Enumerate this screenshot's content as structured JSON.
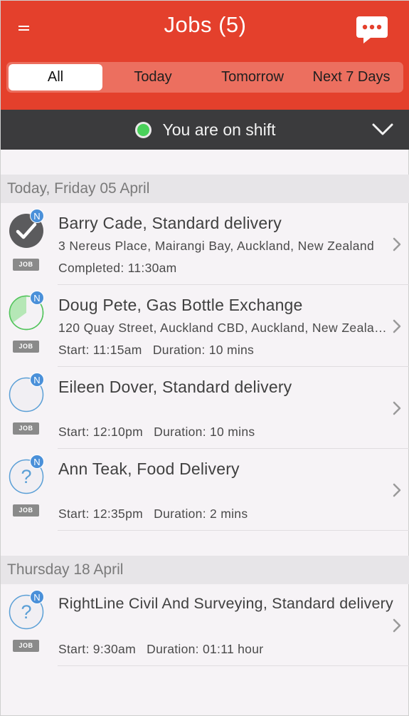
{
  "header": {
    "title": "Jobs (5)",
    "menu_icon": "menu-icon",
    "chat_icon": "chat-bubble-icon",
    "background_color": "#e4402c"
  },
  "tabs": [
    {
      "label": "All",
      "active": true
    },
    {
      "label": "Today",
      "active": false
    },
    {
      "label": "Tomorrow",
      "active": false
    },
    {
      "label": "Next 7 Days",
      "active": false
    }
  ],
  "shift": {
    "status_text": "You are on shift",
    "status_color": "#49d15a",
    "chevron_icon": "chevron-down-icon"
  },
  "sections": [
    {
      "header": "Today, Friday 05 April",
      "jobs": [
        {
          "title": "Barry Cade, Standard delivery",
          "address": "3 Nereus Place, Mairangi Bay, Auckland, New Zealand",
          "status_icon": "completed-check-icon",
          "badge": "N",
          "tag": "JOB",
          "completed_label": "Completed: 11:30am"
        },
        {
          "title": "Doug Pete, Gas Bottle Exchange",
          "address": "120 Quay Street, Auckland CBD, Auckland, New Zealand",
          "status_icon": "progress-pie-icon",
          "progress": 0.35,
          "badge": "N",
          "tag": "JOB",
          "start": "Start: 11:15am",
          "duration": "Duration: 10 mins"
        },
        {
          "title": "Eileen Dover, Standard delivery",
          "address": "",
          "status_icon": "pending-circle-icon",
          "badge": "N",
          "tag": "JOB",
          "start": "Start: 12:10pm",
          "duration": "Duration: 10 mins"
        },
        {
          "title": "Ann Teak, Food Delivery",
          "address": "",
          "status_icon": "unknown-question-icon",
          "badge": "N",
          "tag": "JOB",
          "start": "Start: 12:35pm",
          "duration": "Duration: 2 mins"
        }
      ]
    },
    {
      "header": "Thursday 18 April",
      "jobs": [
        {
          "title": "RightLine Civil And Surveying, Standard delivery",
          "address": "",
          "status_icon": "unknown-question-icon",
          "badge": "N",
          "tag": "JOB",
          "start": "Start: 9:30am",
          "duration": "Duration: 01:11 hour"
        }
      ]
    }
  ]
}
